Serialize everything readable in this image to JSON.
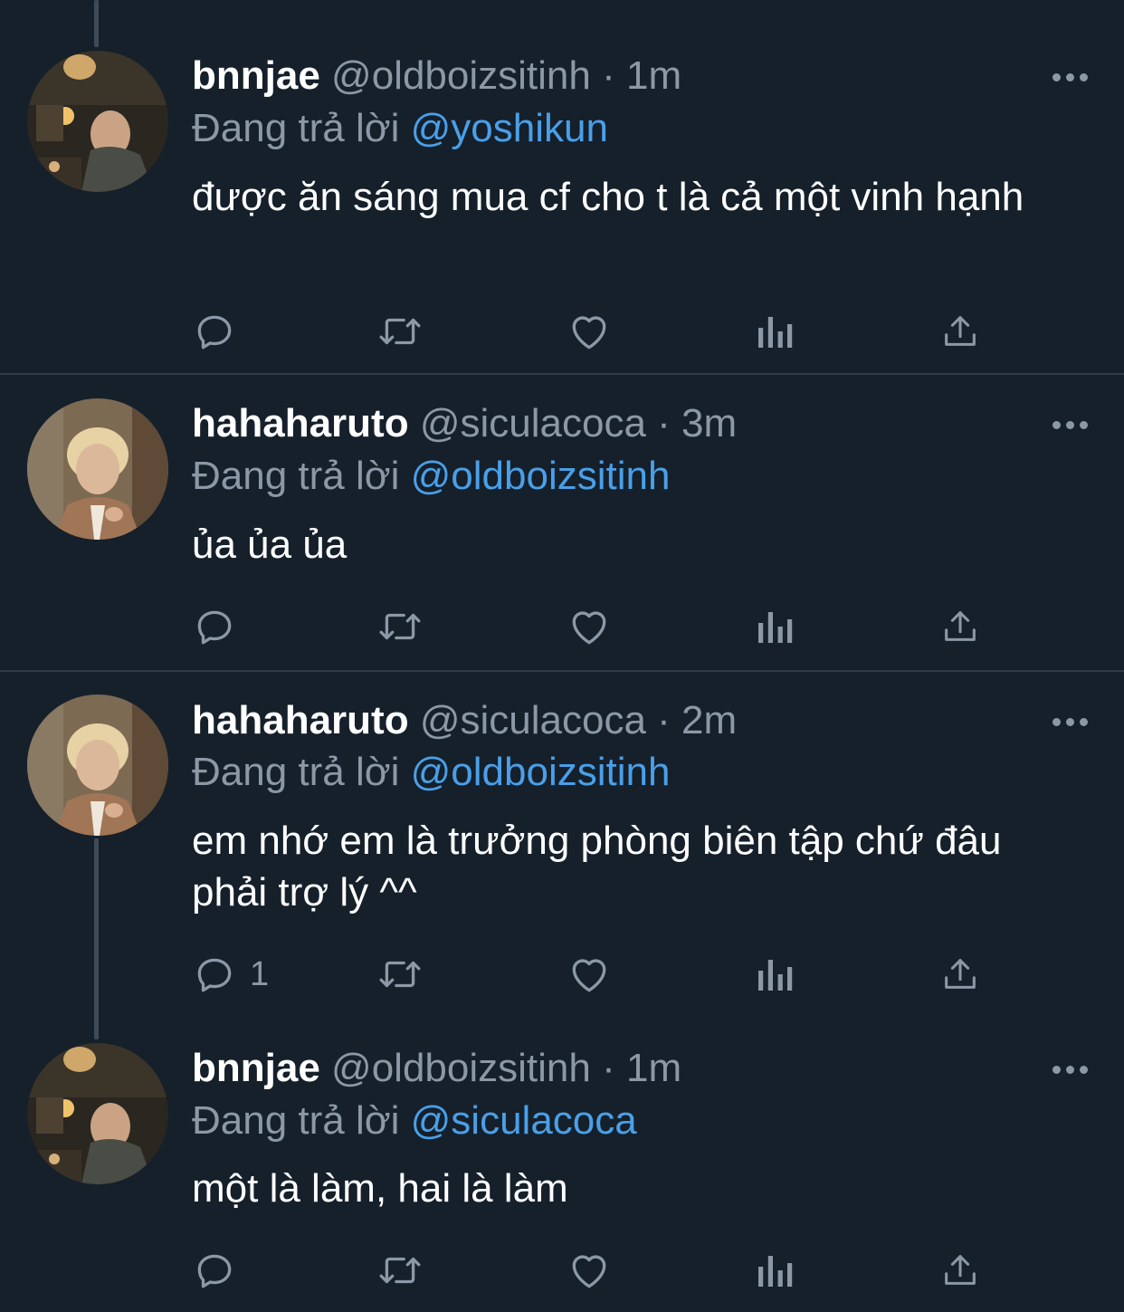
{
  "tweets": [
    {
      "display_name": "bnnjae",
      "handle": "@oldboizsitinh",
      "separator": "·",
      "time": "1m",
      "replying_prefix": "Đang trả lời",
      "replying_to": "@yoshikun",
      "text": "được ăn sáng mua cf cho t là cả một vinh hạnh",
      "reply_count": ""
    },
    {
      "display_name": "hahaharuto",
      "handle": "@siculacoca",
      "separator": "·",
      "time": "3m",
      "replying_prefix": "Đang trả lời",
      "replying_to": "@oldboizsitinh",
      "text": "ủa ủa ủa",
      "reply_count": ""
    },
    {
      "display_name": "hahaharuto",
      "handle": "@siculacoca",
      "separator": "·",
      "time": "2m",
      "replying_prefix": "Đang trả lời",
      "replying_to": "@oldboizsitinh",
      "text": "em nhớ em là trưởng phòng biên tập chứ đâu phải trợ lý ^^",
      "reply_count": "1"
    },
    {
      "display_name": "bnnjae",
      "handle": "@oldboizsitinh",
      "separator": "·",
      "time": "1m",
      "replying_prefix": "Đang trả lời",
      "replying_to": "@siculacoca",
      "text": "một là làm, hai là làm",
      "reply_count": ""
    }
  ],
  "icons": {
    "reply": "reply-icon",
    "retweet": "retweet-icon",
    "like": "heart-icon",
    "views": "analytics-icon",
    "share": "share-icon",
    "more": "more-icon"
  },
  "colors": {
    "background": "#15202b",
    "muted": "#8b98a5",
    "mention": "#4a9fe8",
    "divider": "#2f3b47"
  }
}
